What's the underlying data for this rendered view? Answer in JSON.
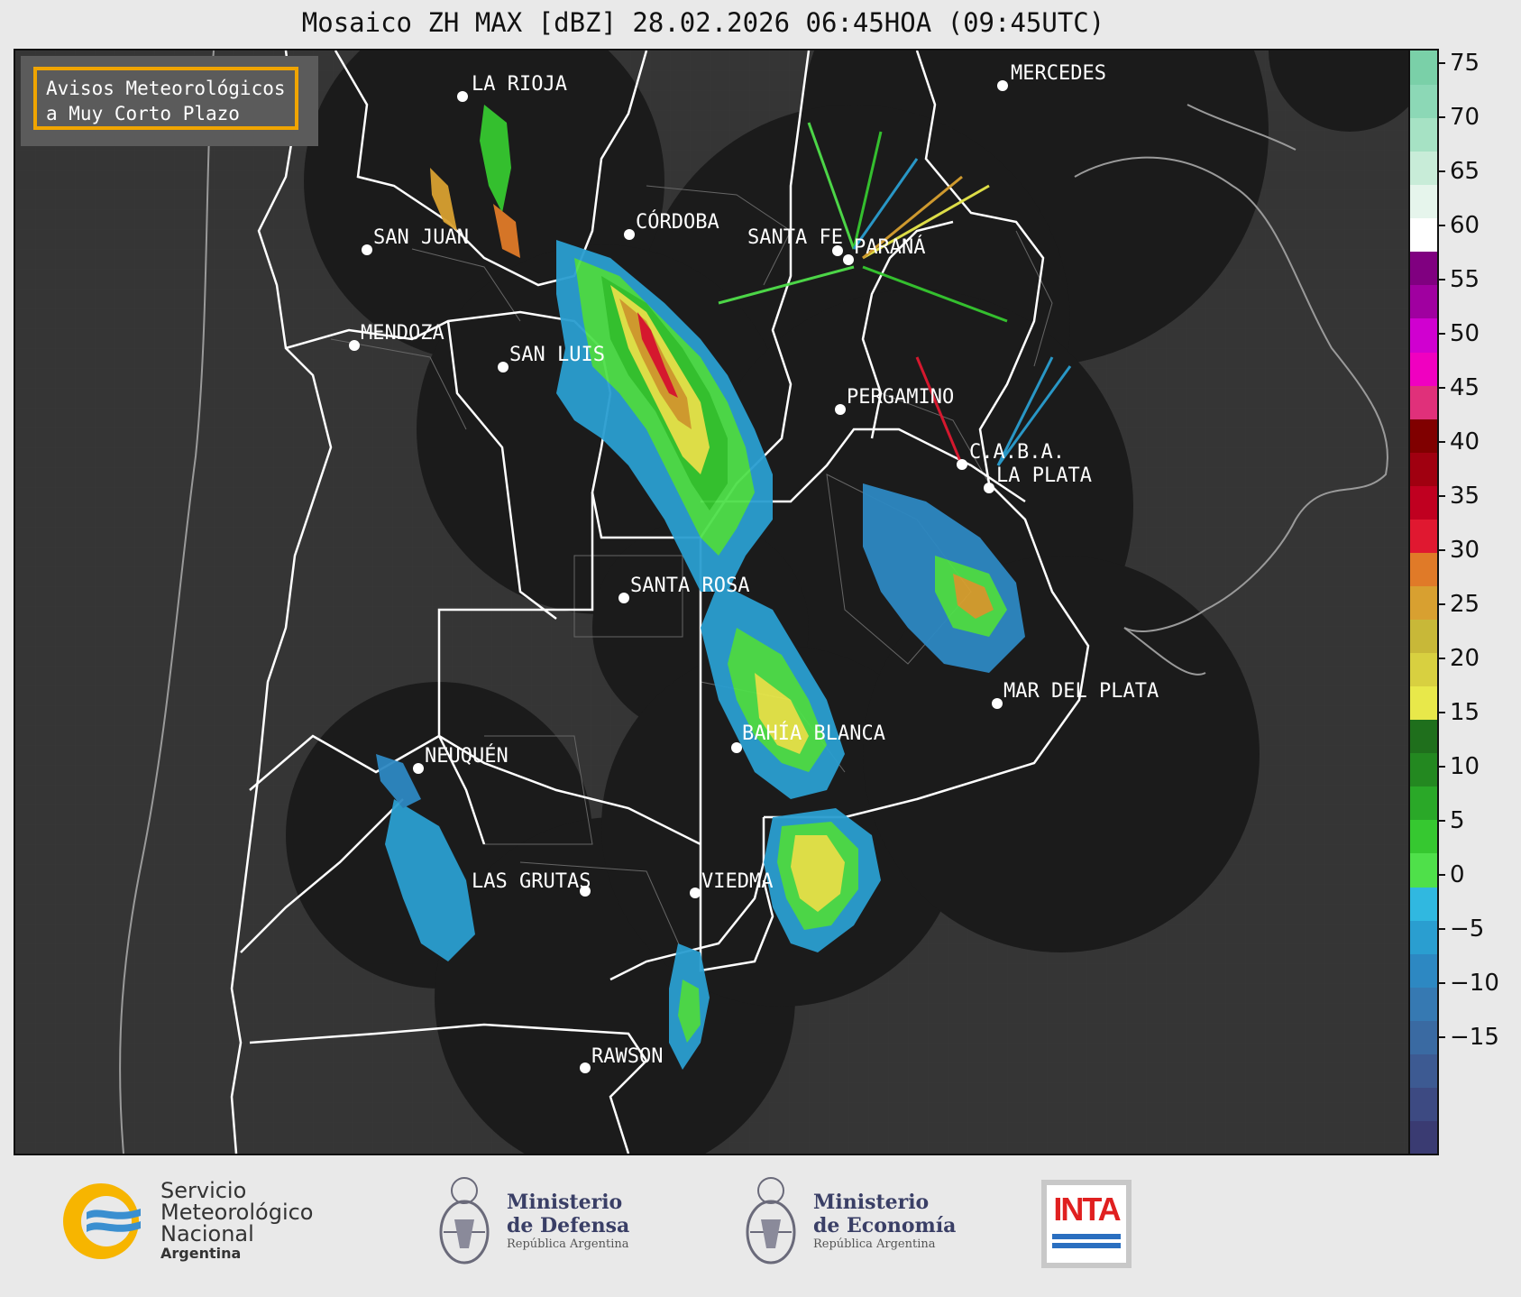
{
  "title": "Mosaico ZH MAX [dBZ] 28.02.2026 06:45HOA (09:45UTC)",
  "notice": {
    "line1": "Avisos Meteorológicos",
    "line2": "a Muy Corto Plazo"
  },
  "colorbar": {
    "ticks": [
      "75",
      "70",
      "65",
      "60",
      "55",
      "50",
      "45",
      "40",
      "35",
      "30",
      "25",
      "20",
      "15",
      "10",
      "5",
      "0",
      "−5",
      "−10",
      "−15"
    ],
    "colors": [
      "#3a3b72",
      "#3d4a82",
      "#3d5a92",
      "#3a6aa2",
      "#3679b2",
      "#2d88c2",
      "#2a9ed0",
      "#30b8e0",
      "#4fe04a",
      "#36c830",
      "#2aa828",
      "#238820",
      "#1f6f1c",
      "#e8e84a",
      "#d8d040",
      "#c8b838",
      "#d8a030",
      "#e07a28",
      "#e01830",
      "#c00020",
      "#a00010",
      "#800000",
      "#e0307a",
      "#f000c0",
      "#d000d0",
      "#a000a0",
      "#800080",
      "#ffffff",
      "#e6f5ec",
      "#c8ecd8",
      "#a6e2c4",
      "#8cd8b6",
      "#7ad0a8"
    ],
    "accent": "#f0a500"
  },
  "cities": [
    {
      "name": "LA RIOJA"
    },
    {
      "name": "MERCEDES"
    },
    {
      "name": "CÓRDOBA"
    },
    {
      "name": "SAN JUAN"
    },
    {
      "name": "SANTA FE"
    },
    {
      "name": "PARANÁ"
    },
    {
      "name": "MENDOZA"
    },
    {
      "name": "SAN LUIS"
    },
    {
      "name": "PERGAMINO"
    },
    {
      "name": "C.A.B.A."
    },
    {
      "name": "LA PLATA"
    },
    {
      "name": "SANTA ROSA"
    },
    {
      "name": "MAR DEL PLATA"
    },
    {
      "name": "BAHÍA BLANCA"
    },
    {
      "name": "NEUQUÉN"
    },
    {
      "name": "LAS GRUTAS"
    },
    {
      "name": "VIEDMA"
    },
    {
      "name": "RAWSON"
    }
  ],
  "footer": {
    "smn": {
      "line1": "Servicio",
      "line2": "Meteorológico",
      "line3": "Nacional",
      "line4": "Argentina"
    },
    "defensa": {
      "line1": "Ministerio",
      "line2": "de Defensa",
      "line3": "República Argentina"
    },
    "economia": {
      "line1": "Ministerio",
      "line2": "de Economía",
      "line3": "República Argentina"
    },
    "inta": {
      "label": "INTA"
    }
  }
}
